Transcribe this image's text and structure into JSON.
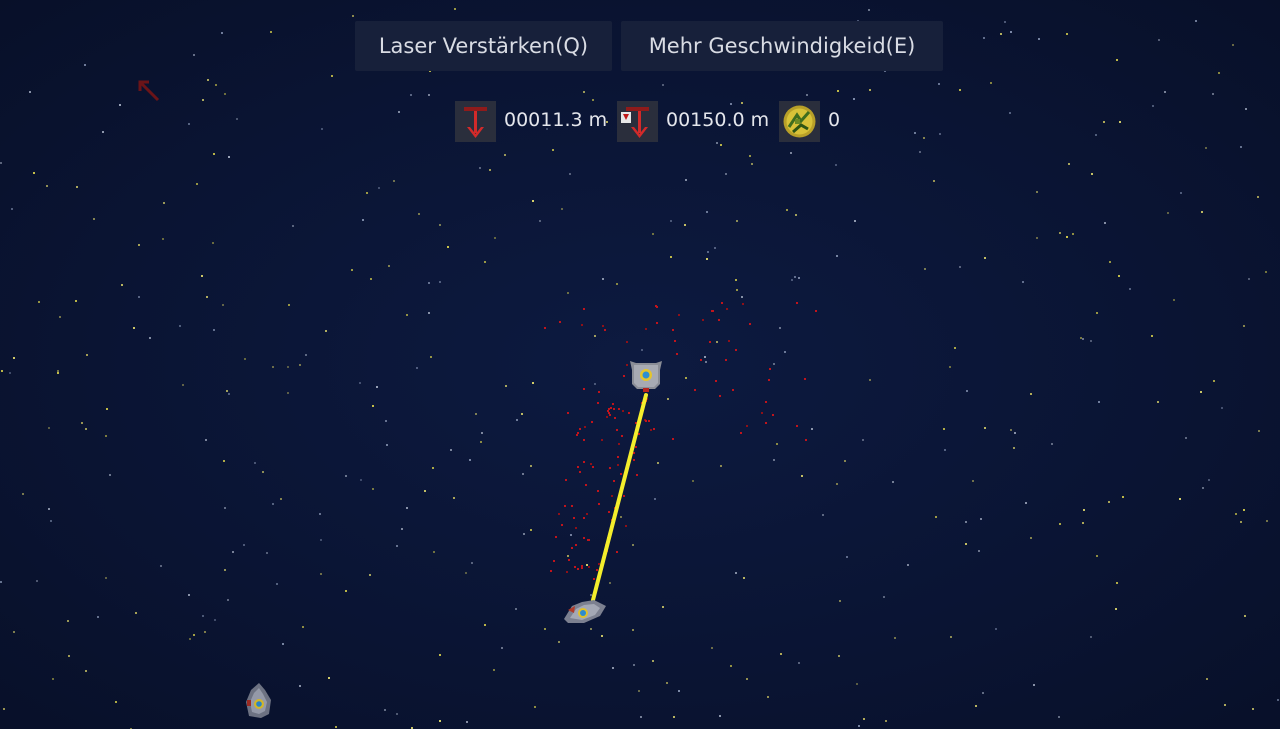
{
  "upgrades": {
    "laser_label": "Laser Verstärken(Q)",
    "speed_label": "Mehr Geschwindigkeid(E)"
  },
  "hud": {
    "depth_value": "00011.3 m",
    "target_depth_value": "00150.0 m",
    "asteroid_count": "0",
    "icons": {
      "depth": "red-down-arrow-icon",
      "target_depth": "target-depth-arrow-icon",
      "asteroid": "asteroid-icon"
    }
  },
  "colors": {
    "background": "#0b1535",
    "laser": "#f4ee2c",
    "debris": "#c0141c",
    "button_bg": "#17203a",
    "star_yellow": "#c8c24a"
  }
}
